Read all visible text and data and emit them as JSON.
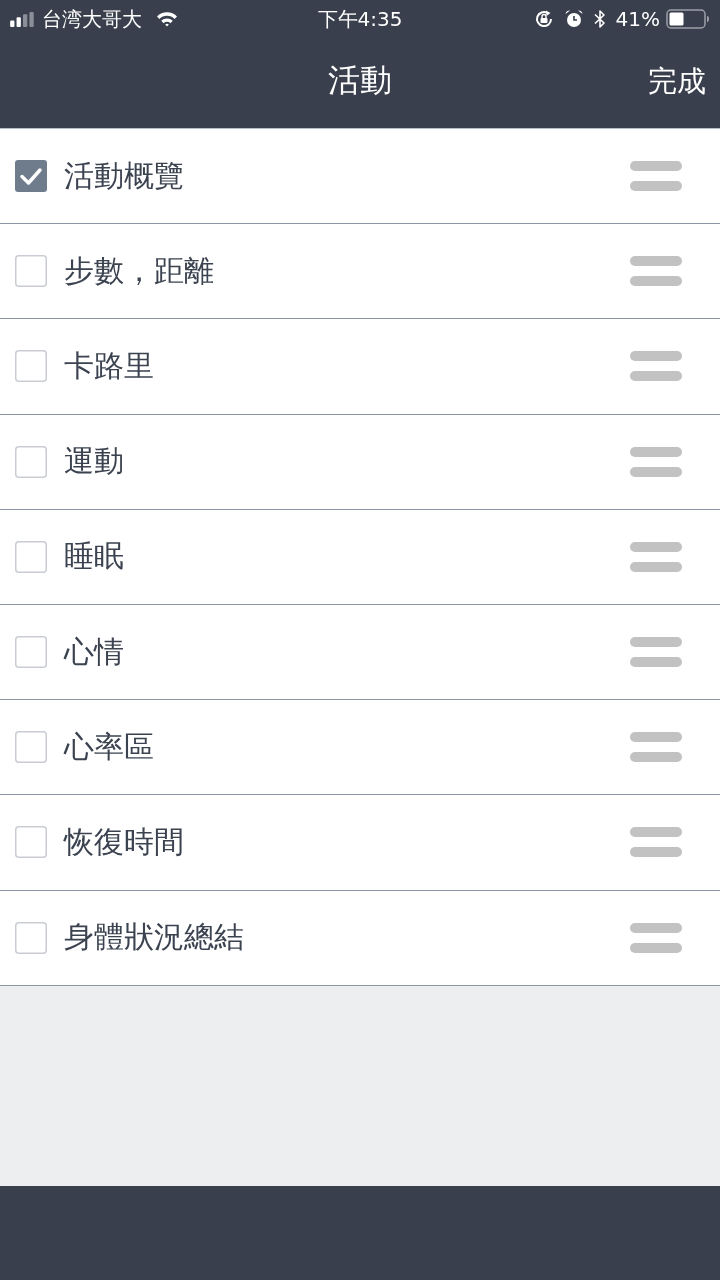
{
  "status_bar": {
    "carrier": "台湾大哥大",
    "time": "下午4:35",
    "battery_text": "41%"
  },
  "nav_bar": {
    "title": "活動",
    "done": "完成"
  },
  "items": [
    {
      "label": "活動概覽",
      "checked": true
    },
    {
      "label": "步數，距離",
      "checked": false
    },
    {
      "label": "卡路里",
      "checked": false
    },
    {
      "label": "運動",
      "checked": false
    },
    {
      "label": "睡眠",
      "checked": false
    },
    {
      "label": "心情",
      "checked": false
    },
    {
      "label": "心率區",
      "checked": false
    },
    {
      "label": "恢復時間",
      "checked": false
    },
    {
      "label": "身體狀況總結",
      "checked": false
    }
  ]
}
